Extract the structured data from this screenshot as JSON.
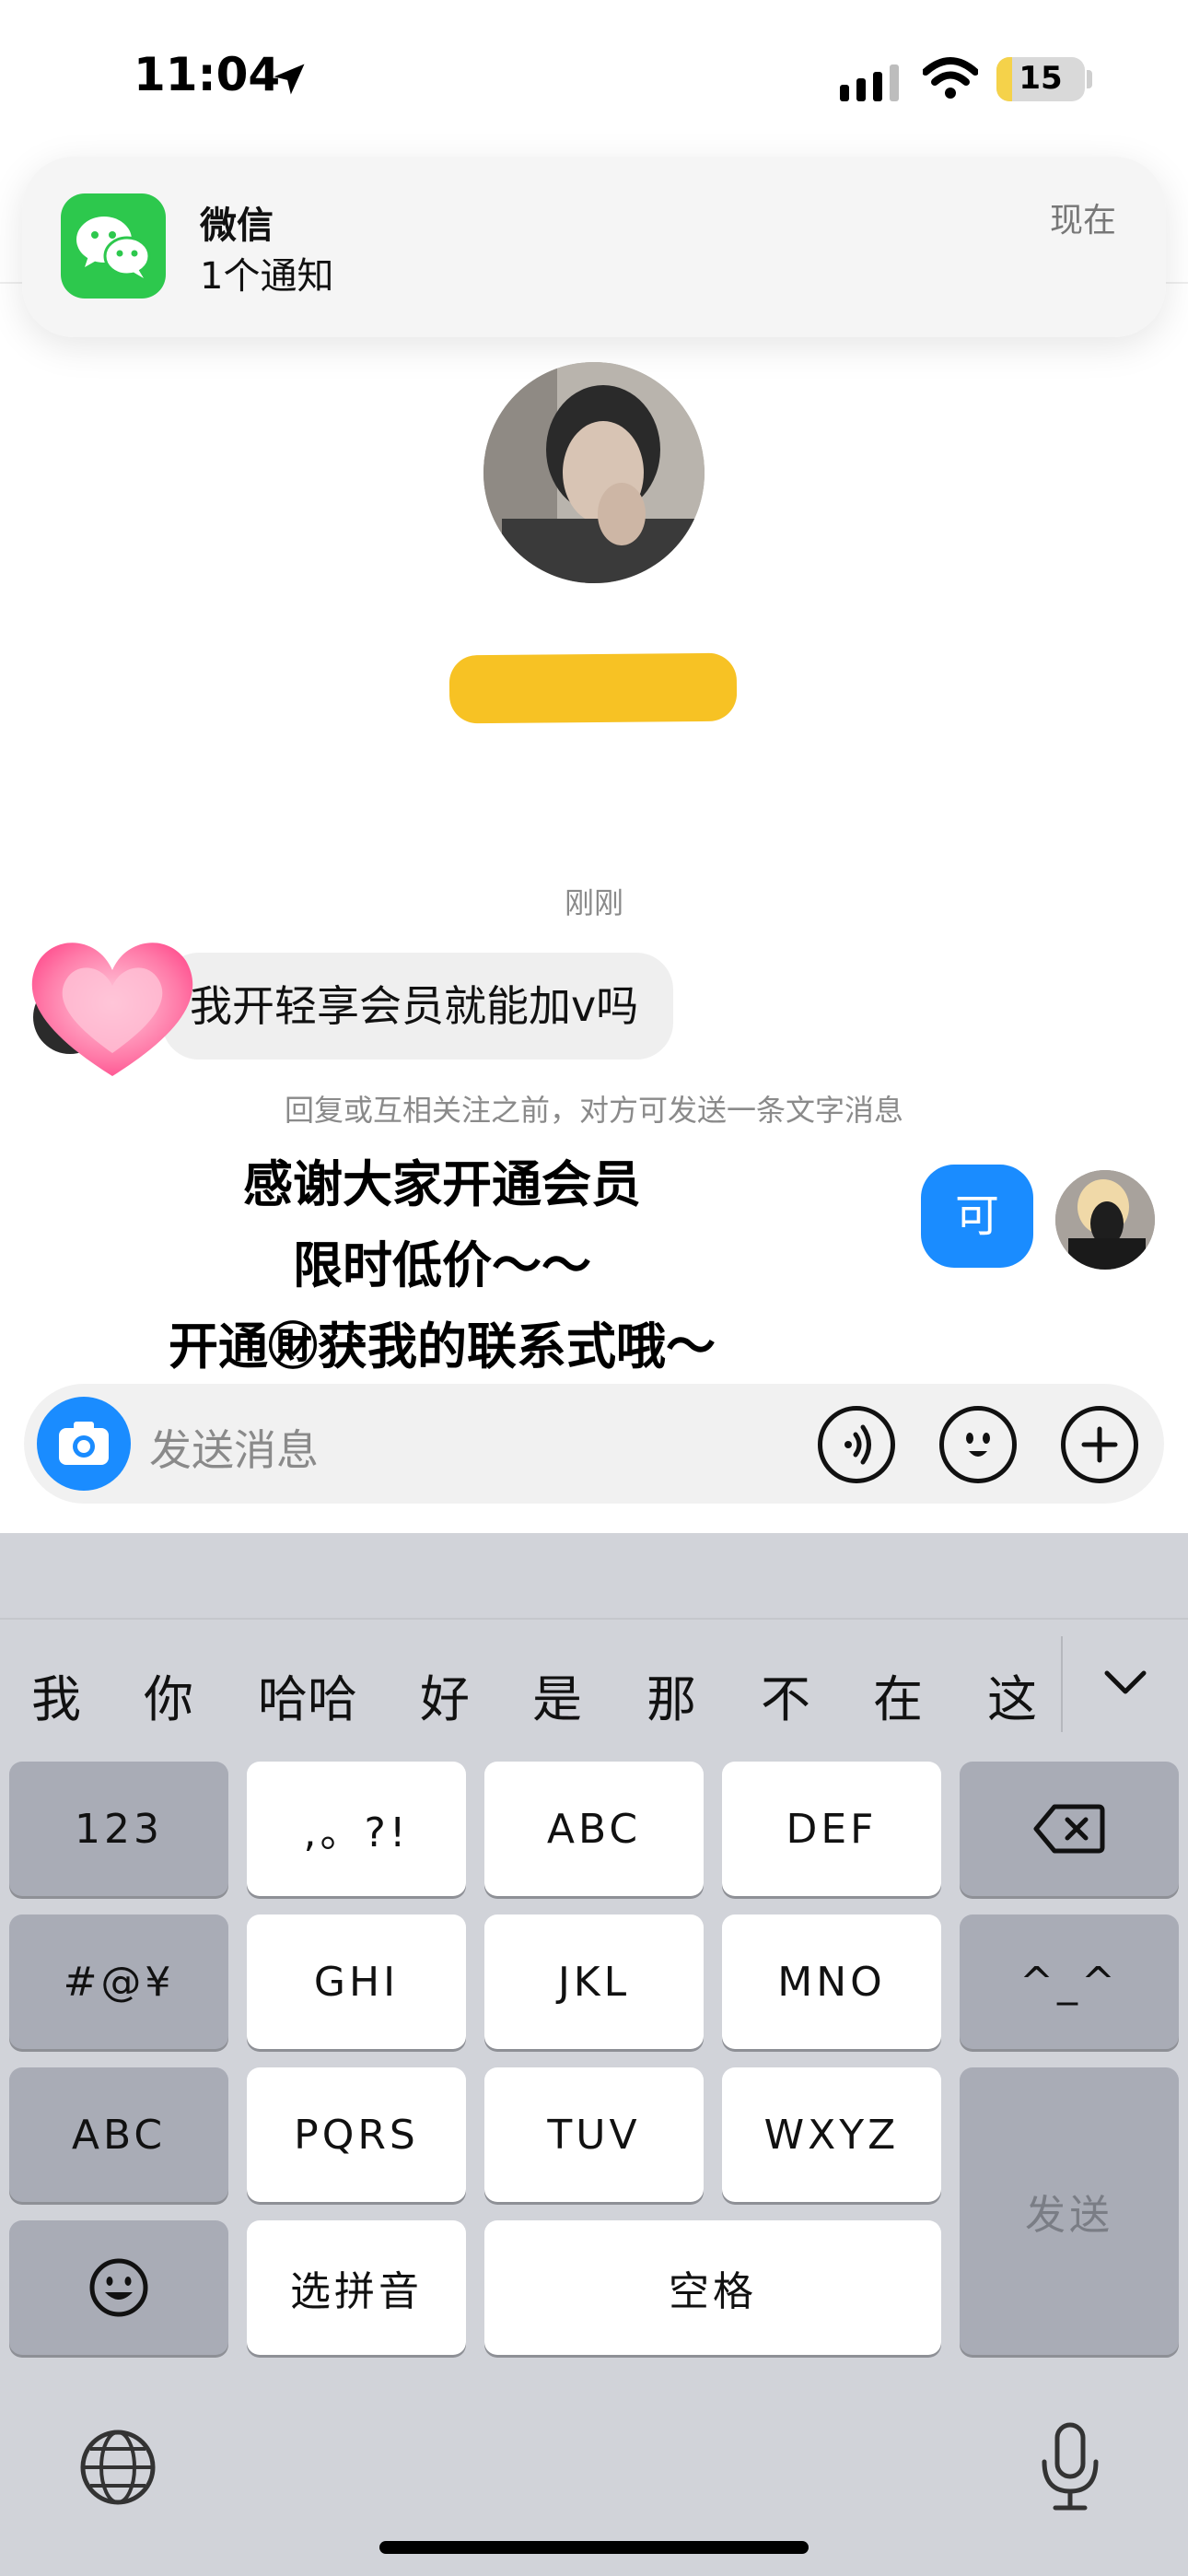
{
  "status_bar": {
    "time": "11:04",
    "battery": "15"
  },
  "notification": {
    "app": "微信",
    "message": "1个通知",
    "time": "现在"
  },
  "chat": {
    "timestamp": "刚刚",
    "incoming_message": "我开轻享会员就能加v吗",
    "notice": "回复或互相关注之前，对方可发送一条文字消息",
    "outgoing_message": "可"
  },
  "promo_overlay": {
    "line1": "感谢大家开通会员",
    "line2": "限时低价～～",
    "line3": "开通㊖获我的联系式哦～"
  },
  "input": {
    "placeholder": "发送消息"
  },
  "keyboard": {
    "candidates": [
      "我",
      "你",
      "哈哈",
      "好",
      "是",
      "那",
      "不",
      "在",
      "这"
    ],
    "rows": [
      [
        "123",
        ",。?!",
        "ABC",
        "DEF"
      ],
      [
        "#@¥",
        "GHI",
        "JKL",
        "MNO",
        "^_^"
      ],
      [
        "ABC",
        "PQRS",
        "TUV",
        "WXYZ"
      ],
      [
        "选拼音",
        "空格"
      ]
    ],
    "send": "发送"
  },
  "icons": {
    "status": [
      "location-arrow-icon",
      "cellular-signal-icon",
      "wifi-icon",
      "battery-icon"
    ],
    "notification": "wechat-icon",
    "input": [
      "camera-icon",
      "voice-icon",
      "emoji-icon",
      "plus-icon"
    ],
    "keyboard": [
      "backspace-icon",
      "emoji-key-icon",
      "chevron-down-icon",
      "globe-icon",
      "microphone-icon"
    ],
    "overlay": "heart-sticker-icon"
  },
  "colors": {
    "accent_blue": "#1a8cff",
    "wechat_green": "#2dc84d",
    "name_highlight": "#f7c224"
  }
}
